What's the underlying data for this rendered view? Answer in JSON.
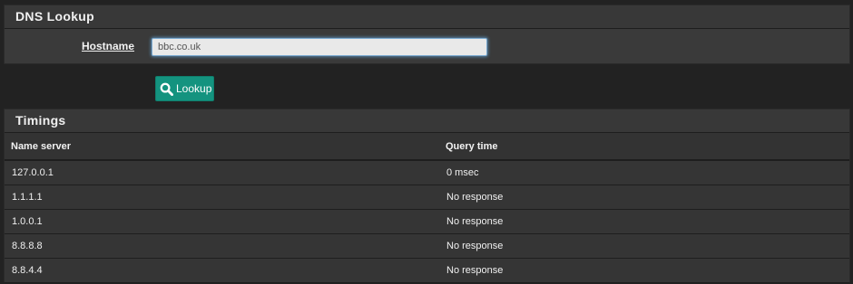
{
  "lookup_panel": {
    "title": "DNS Lookup",
    "hostname_label": "Hostname",
    "hostname_value": "bbc.co.uk",
    "lookup_button_label": "Lookup",
    "lookup_button_icon": "search-icon",
    "button_color": "#14937f"
  },
  "timings_panel": {
    "title": "Timings",
    "columns": [
      "Name server",
      "Query time"
    ],
    "rows": [
      {
        "server": "127.0.0.1",
        "time": "0 msec"
      },
      {
        "server": "1.1.1.1",
        "time": "No response"
      },
      {
        "server": "1.0.0.1",
        "time": "No response"
      },
      {
        "server": "8.8.8.8",
        "time": "No response"
      },
      {
        "server": "8.8.4.4",
        "time": "No response"
      }
    ]
  }
}
